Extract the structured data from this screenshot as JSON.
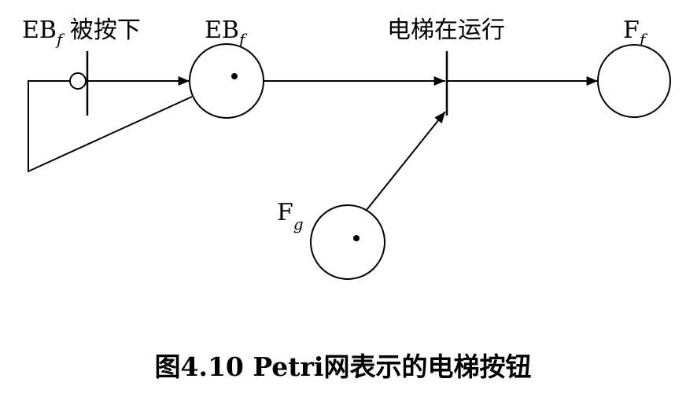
{
  "labels": {
    "t_press_main": "EB",
    "t_press_sub": "f",
    "t_press_suffix": " 被按下",
    "p_ebf_main": "EB",
    "p_ebf_sub": "f",
    "t_running": "电梯在运行",
    "p_ff_main": "F",
    "p_ff_sub": "f",
    "p_fg_main": "F",
    "p_fg_sub": "g"
  },
  "caption": "图4.10 Petri网表示的电梯按钮",
  "tokens": {
    "place_ebf": 1,
    "place_ff": 0,
    "place_fg": 1
  }
}
